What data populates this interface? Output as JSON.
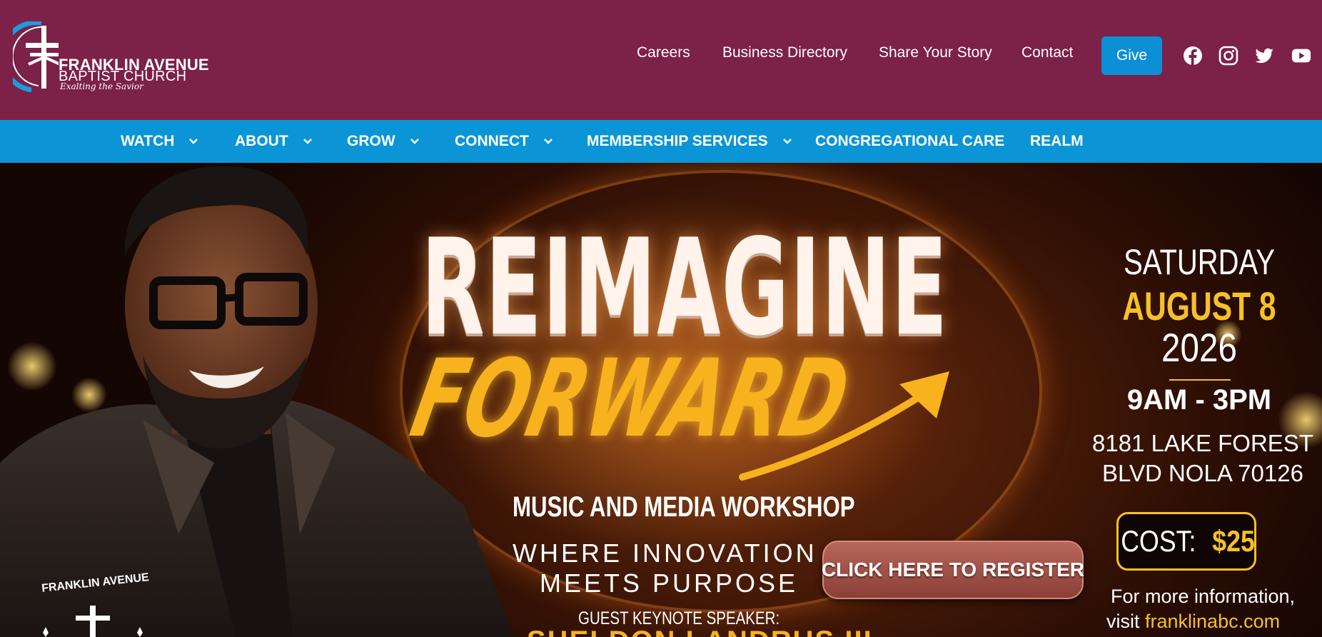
{
  "header": {
    "logo": {
      "line1": "FRANKLIN AVENUE",
      "line2": "BAPTIST CHURCH",
      "tagline": "Exalting the Savior"
    },
    "utility_nav": [
      "Careers",
      "Business Directory",
      "Share Your Story",
      "Contact"
    ],
    "give_label": "Give",
    "social": [
      "facebook-icon",
      "instagram-icon",
      "twitter-icon",
      "youtube-icon"
    ]
  },
  "main_nav": {
    "items": [
      {
        "label": "WATCH",
        "dropdown": true
      },
      {
        "label": "ABOUT",
        "dropdown": true
      },
      {
        "label": "GROW",
        "dropdown": true
      },
      {
        "label": "CONNECT",
        "dropdown": true
      },
      {
        "label": "MEMBERSHIP SERVICES",
        "dropdown": true
      },
      {
        "label": "CONGREGATIONAL CARE",
        "dropdown": false
      },
      {
        "label": "REALM",
        "dropdown": false
      }
    ]
  },
  "hero": {
    "title_line1": "REIMAGINE",
    "title_line2": "FORWARD",
    "subtitle": "MUSIC AND MEDIA WORKSHOP",
    "tagline_line1": "WHERE INNOVATION",
    "tagline_line2": "MEETS PURPOSE",
    "keynote_label": "GUEST KEYNOTE SPEAKER:",
    "speaker_name": "SHELDON LANDRUS III",
    "register_label": "CLICK HERE TO REGISTER",
    "badge_text": "FRANKLIN AVENUE",
    "event": {
      "day": "SATURDAY",
      "date": "AUGUST 8",
      "year": "2026",
      "time": "9AM - 3PM",
      "address_line1": "8181 LAKE FOREST",
      "address_line2": "BLVD NOLA 70126",
      "cost_label": "COST:",
      "cost_value": "$25",
      "more_info": "For more information,",
      "visit_label": "visit",
      "visit_url": "franklinabc.com"
    }
  },
  "colors": {
    "header_bg": "#7c2148",
    "nav_bg": "#0b95d6",
    "give_bg": "#0d8fd6",
    "accent_gold": "#f7c026"
  }
}
